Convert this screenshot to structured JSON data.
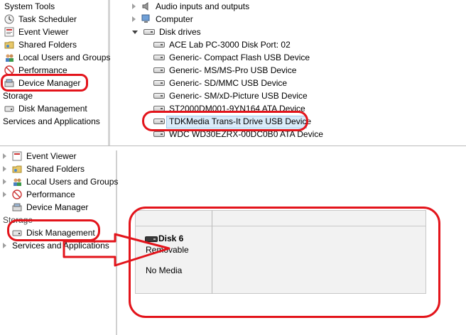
{
  "top_left_tree": {
    "items": [
      {
        "label": "System Tools",
        "icon": "system-tools-icon"
      },
      {
        "label": "Task Scheduler",
        "icon": "clock-icon"
      },
      {
        "label": "Event Viewer",
        "icon": "event-viewer-icon"
      },
      {
        "label": "Shared Folders",
        "icon": "shared-folder-icon"
      },
      {
        "label": "Local Users and Groups",
        "icon": "users-icon"
      },
      {
        "label": "Performance",
        "icon": "performance-icon"
      },
      {
        "label": "Device Manager",
        "icon": "device-manager-icon"
      },
      {
        "label": "Storage",
        "icon": ""
      },
      {
        "label": "Disk Management",
        "icon": "disk-management-icon"
      },
      {
        "label": "Services and Applications",
        "icon": ""
      }
    ]
  },
  "top_right_tree": {
    "items": [
      {
        "label": "Audio inputs and outputs"
      },
      {
        "label": "Computer"
      },
      {
        "label": "Disk drives"
      }
    ],
    "disk_drives": [
      "ACE Lab PC-3000 Disk Port: 02",
      "Generic- Compact Flash USB Device",
      "Generic- MS/MS-Pro USB Device",
      "Generic- SD/MMC USB Device",
      "Generic- SM/xD-Picture USB Device",
      "ST2000DM001-9YN164 ATA Device",
      "TDKMedia Trans-It Drive USB Device",
      "WDC WD30EZRX-00DC0B0 ATA Device"
    ]
  },
  "bottom_left_tree": {
    "items": [
      {
        "label": "Event Viewer"
      },
      {
        "label": "Shared Folders"
      },
      {
        "label": "Local Users and Groups"
      },
      {
        "label": "Performance"
      },
      {
        "label": "Device Manager"
      },
      {
        "label": "Storage"
      },
      {
        "label": "Disk Management"
      },
      {
        "label": "Services and Applications"
      }
    ]
  },
  "disk_panel": {
    "disk_name": "Disk 6",
    "disk_type": "Removable",
    "media_status": "No Media"
  },
  "colors": {
    "annotation_red": "#e3141b",
    "selection_blue": "#d9ebf9"
  }
}
